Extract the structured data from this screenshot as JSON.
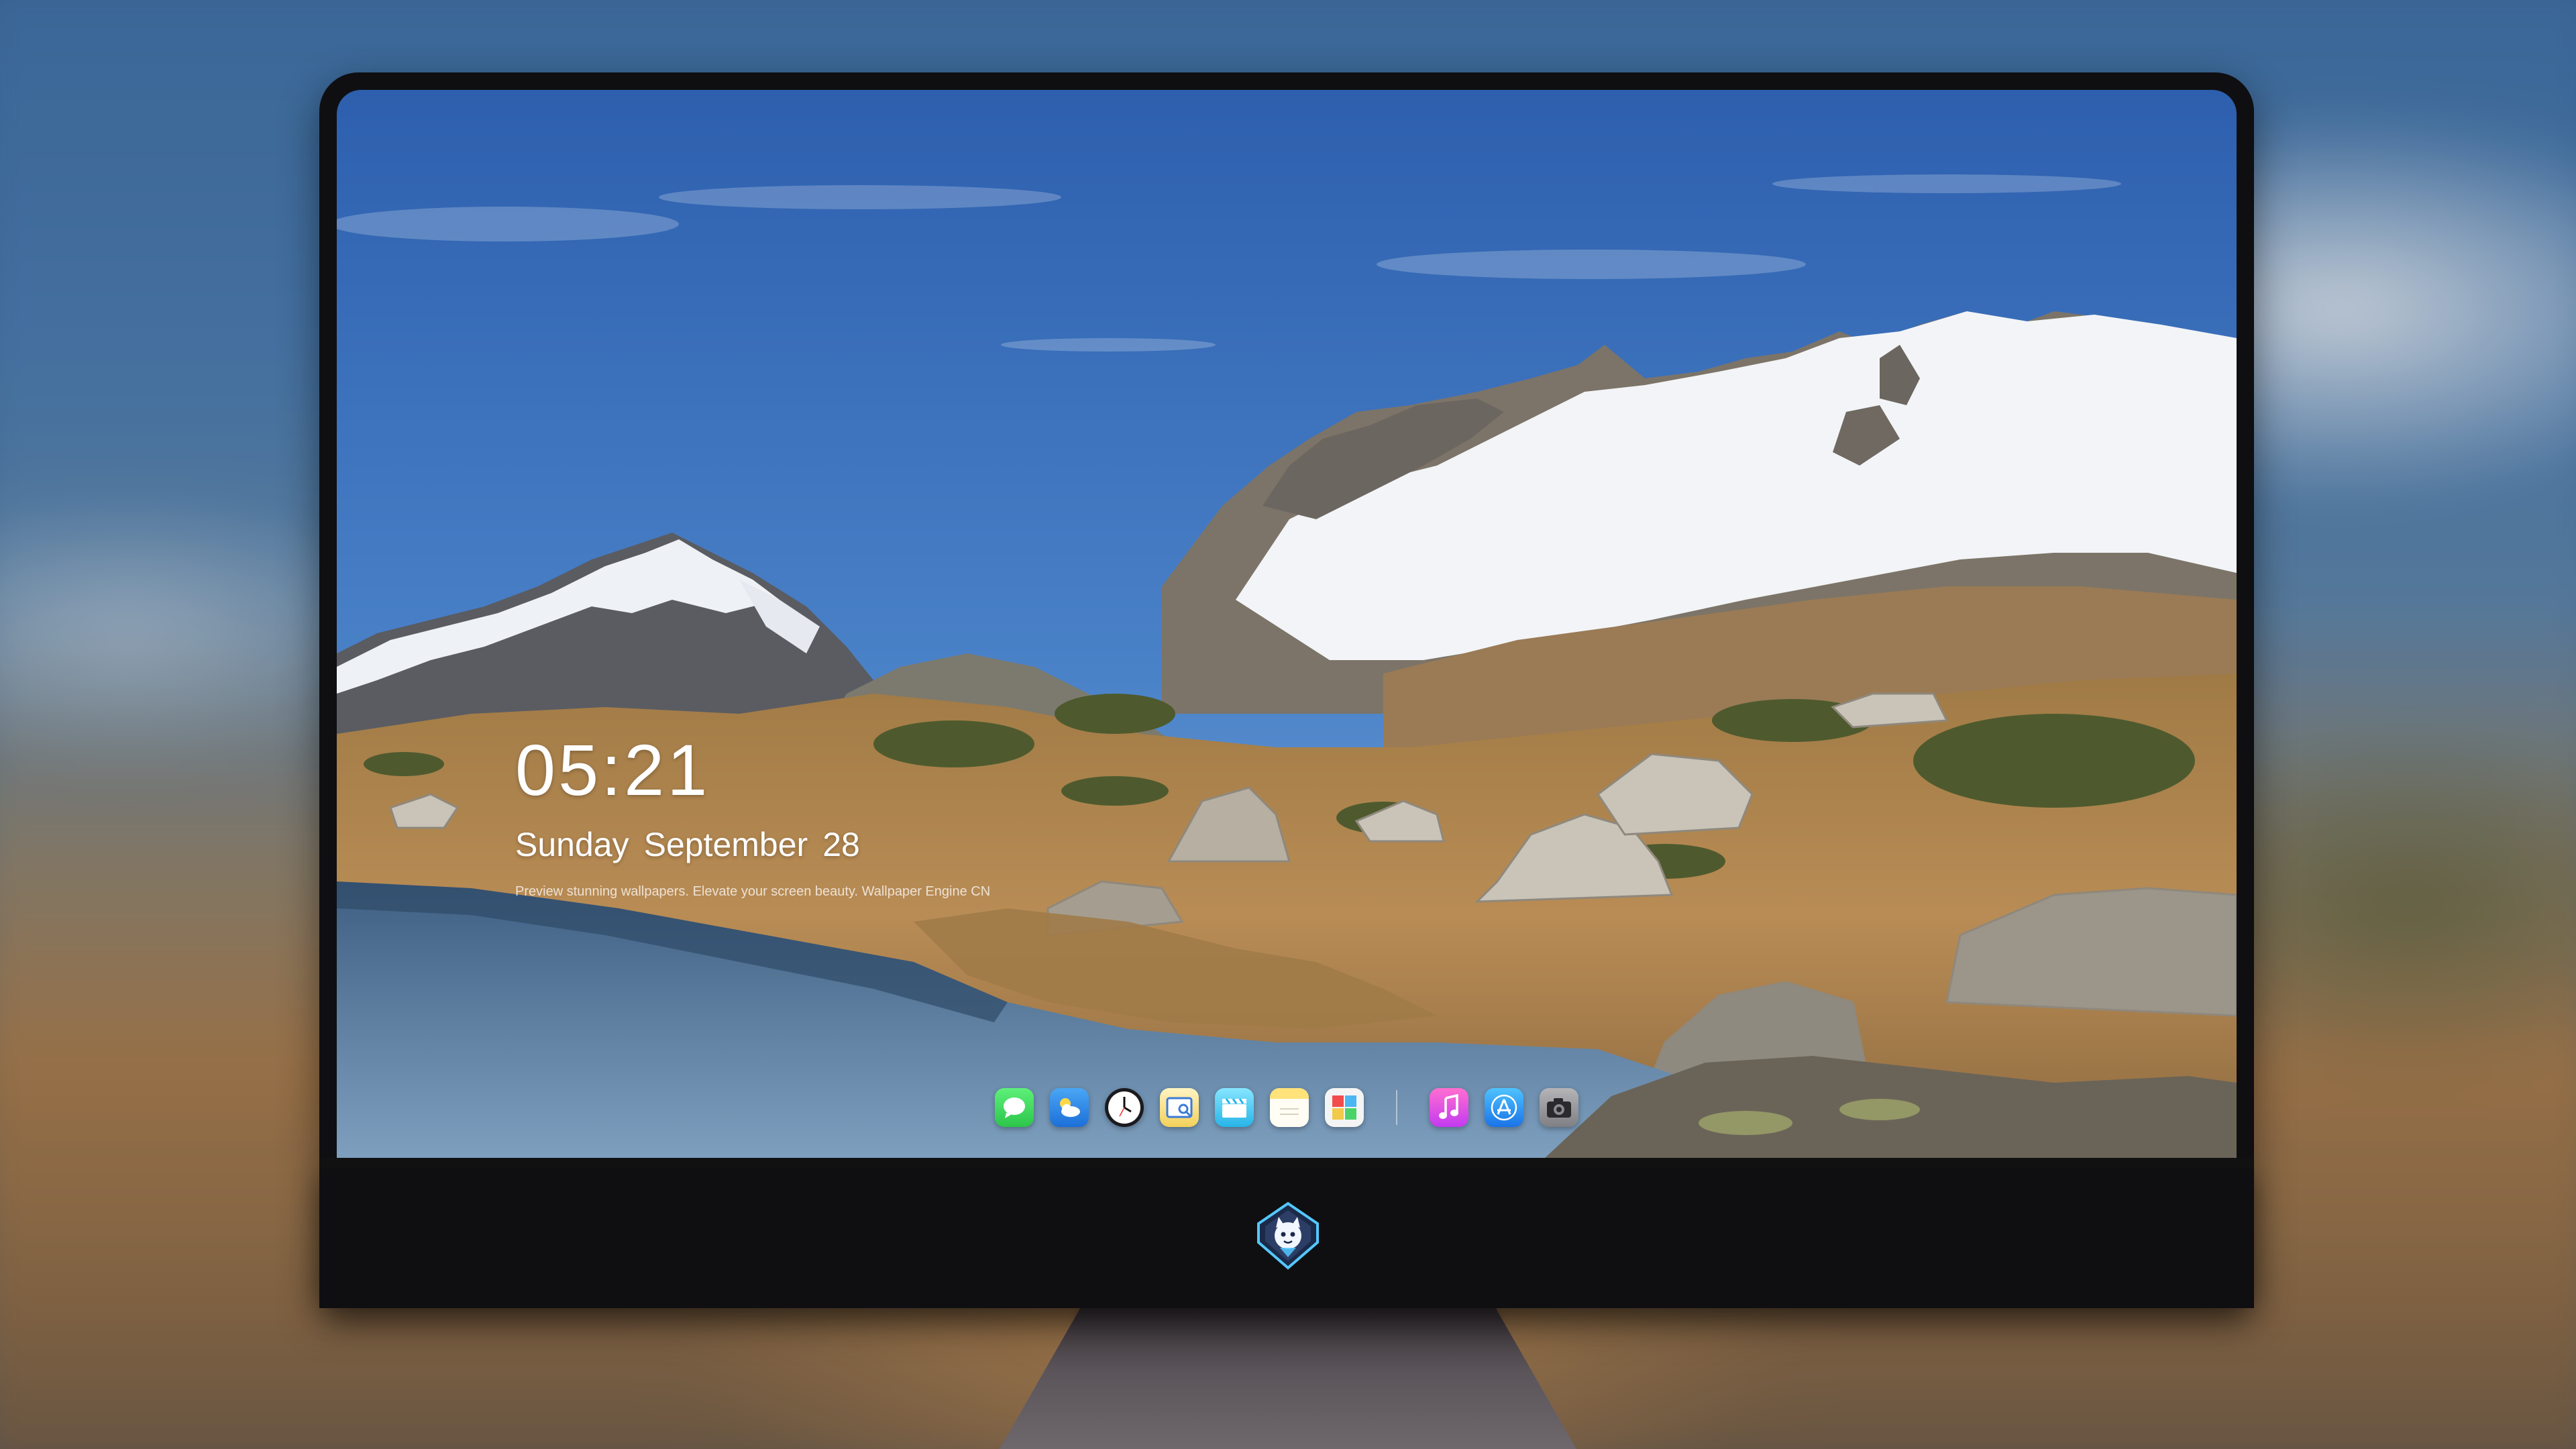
{
  "lock_screen": {
    "time": "05:21",
    "date": {
      "weekday": "Sunday",
      "month": "September",
      "day": "28"
    },
    "tagline": "Preview stunning wallpapers. Elevate your screen beauty. Wallpaper Engine CN"
  },
  "dock": {
    "apps": [
      {
        "name": "Messages",
        "icon": "messages-icon"
      },
      {
        "name": "Weather",
        "icon": "weather-icon"
      },
      {
        "name": "Clock",
        "icon": "clock-icon"
      },
      {
        "name": "Preview",
        "icon": "preview-icon"
      },
      {
        "name": "Clips",
        "icon": "clapperboard-icon"
      },
      {
        "name": "Notes",
        "icon": "notes-icon"
      },
      {
        "name": "Photo Booth",
        "icon": "photos-grid-icon"
      },
      {
        "name": "Music",
        "icon": "music-icon"
      },
      {
        "name": "App Store",
        "icon": "app-store-icon"
      },
      {
        "name": "Camera",
        "icon": "camera-icon"
      }
    ]
  },
  "brand": {
    "logo_icon": "cat-shield-logo-icon"
  },
  "colors": {
    "sky_top": "#2f63b3",
    "sky_bottom": "#8bb4dc",
    "snow": "#f4f6f9",
    "grass": "#b58a52",
    "water": "#5f86aa",
    "bezel": "#0f0f12",
    "chin": "#463e44"
  }
}
